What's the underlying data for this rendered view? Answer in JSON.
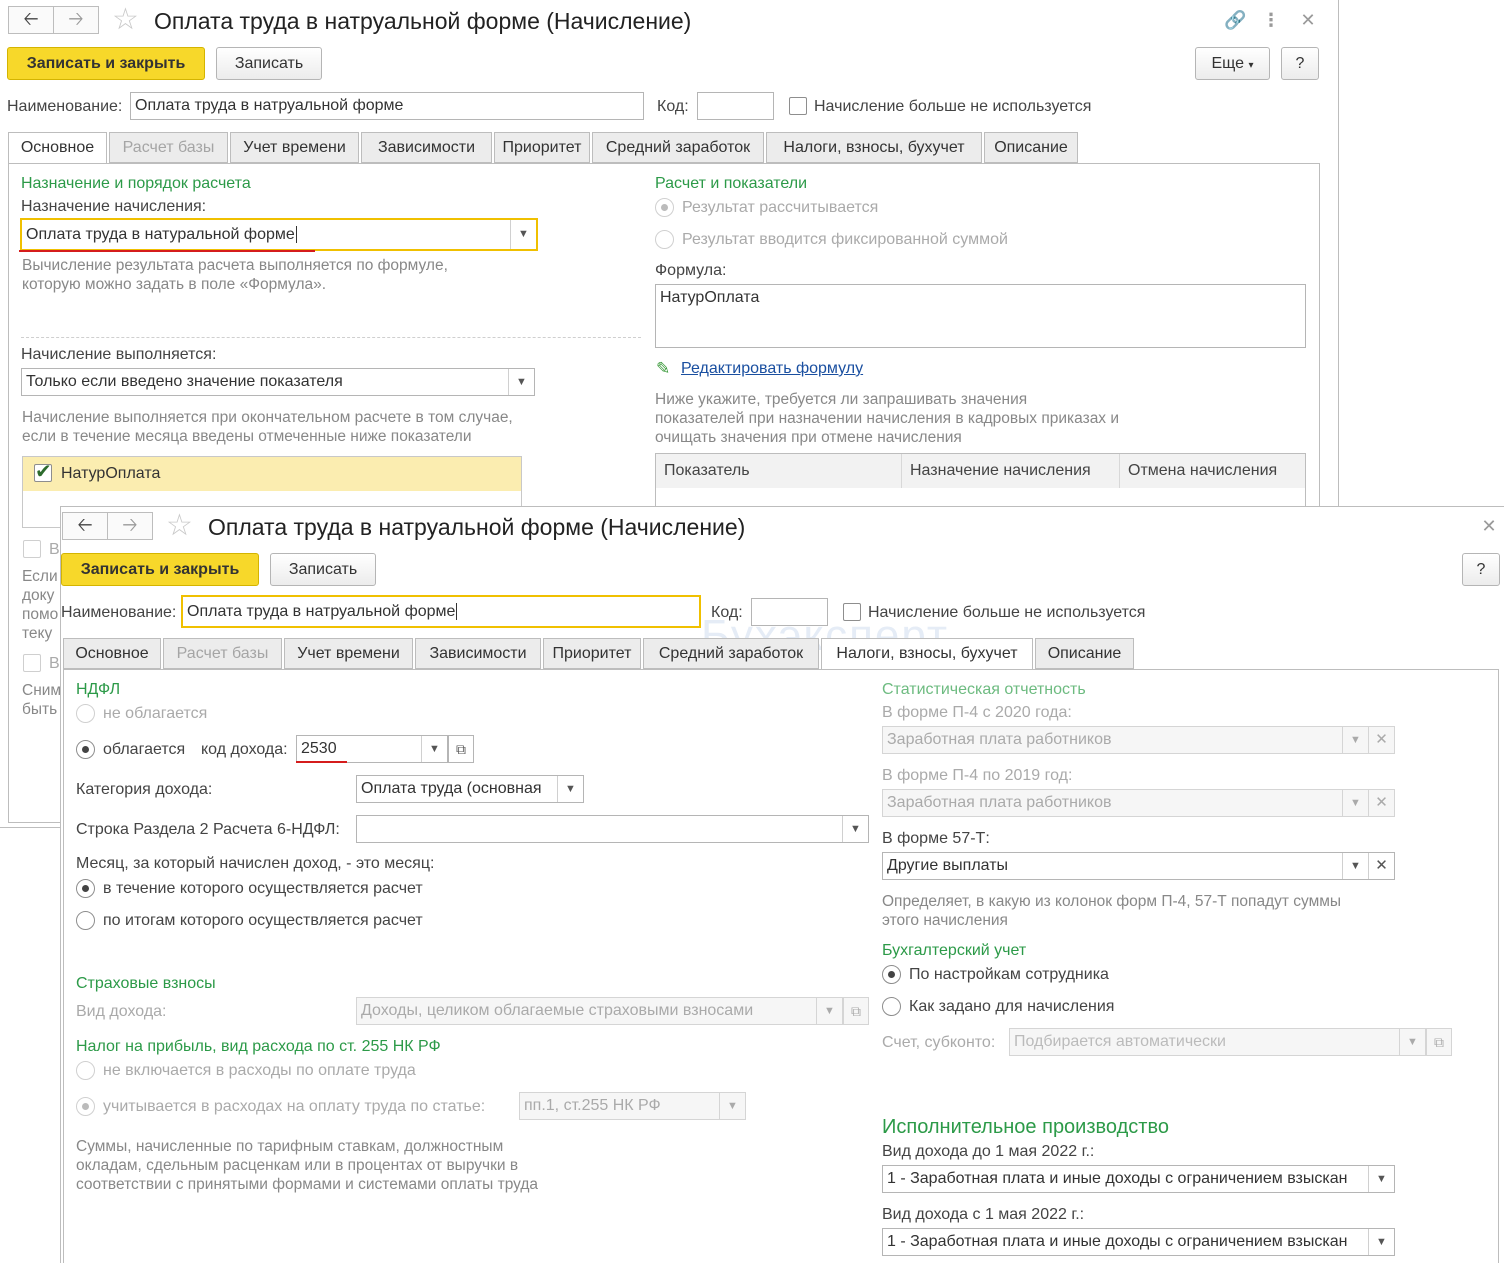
{
  "back": {
    "title": "Оплата труда в натруальной форме (Начисление)",
    "save_close": "Записать и закрыть",
    "save": "Записать",
    "more": "Еще",
    "help": "?",
    "name_label": "Наименование:",
    "name_value": "Оплата труда в натруальной форме",
    "code_label": "Код:",
    "code_value": "",
    "unused_label": "Начисление больше не используется",
    "tabs": [
      "Основное",
      "Расчет базы",
      "Учет времени",
      "Зависимости",
      "Приоритет",
      "Средний заработок",
      "Налоги, взносы, бухучет",
      "Описание"
    ],
    "purpose_section": "Назначение и порядок расчета",
    "purpose_label": "Назначение начисления:",
    "purpose_value": "Оплата труда в натуральной форме",
    "purpose_note_1": "Вычисление результата расчета выполняется по формуле,",
    "purpose_note_2": "которую можно задать в поле «Формула».",
    "exec_label": "Начисление выполняется:",
    "exec_value": "Только если введено значение показателя",
    "exec_note_1": "Начисление выполняется при окончательном расчете в том случае,",
    "exec_note_2": "если в течение месяца введены отмеченные ниже показатели",
    "indicator_item": "НатурОплата",
    "calc_section": "Расчет и показатели",
    "result_calc": "Результат рассчитывается",
    "result_fixed": "Результат вводится фиксированной суммой",
    "formula_label": "Формула:",
    "formula_value": "НатурОплата",
    "edit_formula": "Редактировать формулу",
    "indicators_note_1": "Ниже укажите, требуется ли запрашивать значения",
    "indicators_note_2": "показателей при назначении начисления в кадровых приказах и",
    "indicators_note_3": "очищать значения при отмене начисления",
    "table_headers": [
      "Показатель",
      "Назначение начисления",
      "Отмена начисления"
    ],
    "hidden_left": [
      "В",
      "Если",
      "доку",
      "помо",
      "теку",
      "В",
      "Сним",
      "быть"
    ]
  },
  "front": {
    "title": "Оплата труда в натруальной форме (Начисление)",
    "save_close": "Записать и закрыть",
    "save": "Записать",
    "help": "?",
    "name_label": "Наименование:",
    "name_value": "Оплата труда в натруальной форме",
    "code_label": "Код:",
    "code_value": "",
    "unused_label": "Начисление больше не используется",
    "tabs": [
      "Основное",
      "Расчет базы",
      "Учет времени",
      "Зависимости",
      "Приоритет",
      "Средний заработок",
      "Налоги, взносы, бухучет",
      "Описание"
    ],
    "watermark": "Бухэксперт",
    "ndfl": {
      "section": "НДФЛ",
      "not_taxed": "не облагается",
      "taxed": "облагается",
      "income_code_label": "код дохода:",
      "income_code": "2530",
      "category_label": "Категория дохода:",
      "category_value": "Оплата труда (основная",
      "line6_label": "Строка Раздела 2 Расчета 6-НДФЛ:",
      "line6_value": "",
      "month_label": "Месяц, за который начислен доход, - это месяц:",
      "month_during": "в течение которого осуществляется расчет",
      "month_after": "по итогам которого осуществляется расчет"
    },
    "insurance": {
      "section": "Страховые взносы",
      "income_type_label": "Вид дохода:",
      "income_type_value": "Доходы, целиком облагаемые страховыми взносами"
    },
    "profit": {
      "section": "Налог на прибыль, вид расхода по ст. 255 НК РФ",
      "not_included": "не включается в расходы по оплате труда",
      "included": "учитывается в расходах на оплату труда по статье:",
      "article_value": "пп.1, ст.255 НК РФ",
      "note_1": "Суммы, начисленные по тарифным ставкам, должностным",
      "note_2": "окладам, сдельным расценкам или в процентах от выручки в",
      "note_3": "соответствии с принятыми формами и системами оплаты труда"
    },
    "stats": {
      "section": "Статистическая отчетность",
      "p4_2020_label": "В форме П-4 с 2020 года:",
      "p4_2020_value": "Заработная плата работников",
      "p4_2019_label": "В форме П-4 по 2019 год:",
      "p4_2019_value": "Заработная плата работников",
      "f57_label": "В форме 57-Т:",
      "f57_value": "Другие выплаты",
      "note_1": "Определяет, в какую из колонок форм П-4, 57-Т попадут суммы",
      "note_2": "этого начисления"
    },
    "accounting": {
      "section": "Бухгалтерский учет",
      "by_employee": "По настройкам сотрудника",
      "as_set": "Как задано для начисления",
      "account_label": "Счет, субконто:",
      "account_placeholder": "Подбирается автоматически"
    },
    "enforcement": {
      "section": "Исполнительное производство",
      "before_label": "Вид дохода до 1 мая 2022 г.:",
      "before_value": "1 - Заработная плата и иные доходы с ограничением взыскан",
      "after_label": "Вид дохода с 1 мая 2022 г.:",
      "after_value": "1 - Заработная плата и иные доходы с ограничением взыскан"
    }
  },
  "colors": {
    "primary_button": "#f7d82a",
    "section_green": "#2c9a48",
    "focus_yellow": "#f0c000",
    "underline_red": "#d51c1c",
    "link_blue": "#1a4fa0"
  },
  "icons": [
    "arrow-left-icon",
    "arrow-right-icon",
    "star-icon",
    "link-icon",
    "more-vert-icon",
    "close-icon",
    "dropdown-arrow-icon",
    "clear-icon",
    "open-icon",
    "checkmark-icon",
    "pencil-icon"
  ]
}
